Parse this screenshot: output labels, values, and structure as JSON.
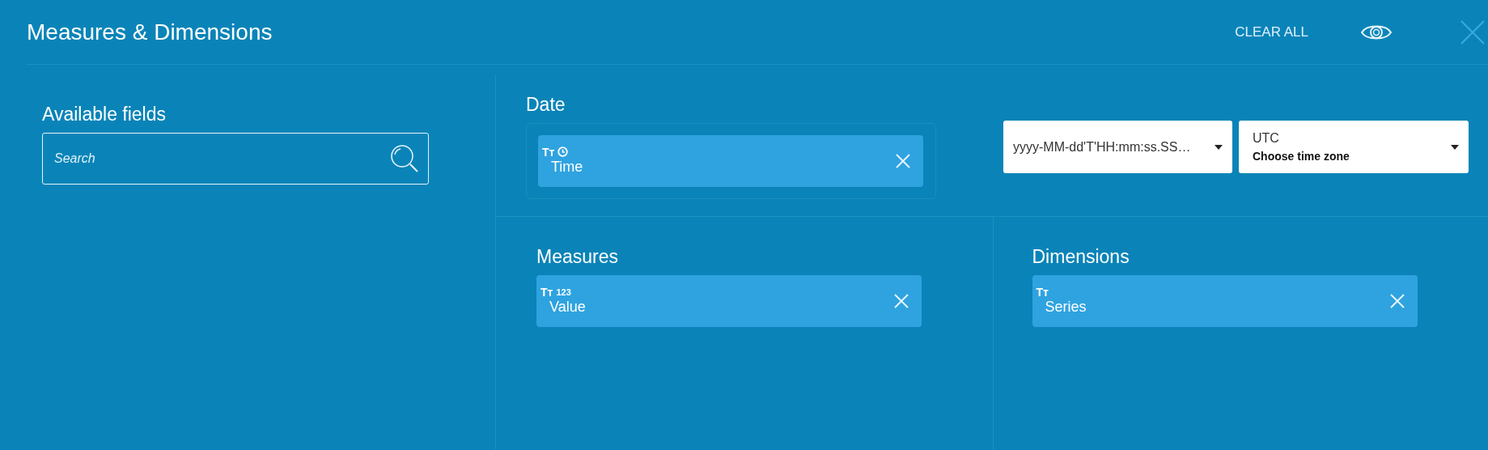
{
  "header": {
    "title": "Measures & Dimensions",
    "clear_all": "CLEAR ALL"
  },
  "available": {
    "title": "Available fields",
    "search": {
      "placeholder": "Search"
    }
  },
  "date": {
    "title": "Date",
    "fields": [
      {
        "kind": "date",
        "type_glyph": "Tт",
        "name": "Time"
      }
    ],
    "format": {
      "value": "yyyy-MM-dd'T'HH:mm:ss.SS…"
    },
    "timezone": {
      "value": "UTC",
      "hint": "Choose time zone"
    }
  },
  "measures": {
    "title": "Measures",
    "fields": [
      {
        "kind": "number",
        "type_glyph": "Tт",
        "type_badge": "123",
        "name": "Value"
      }
    ]
  },
  "dimensions": {
    "title": "Dimensions",
    "fields": [
      {
        "type_glyph": "Tт",
        "name": "Series"
      }
    ]
  }
}
